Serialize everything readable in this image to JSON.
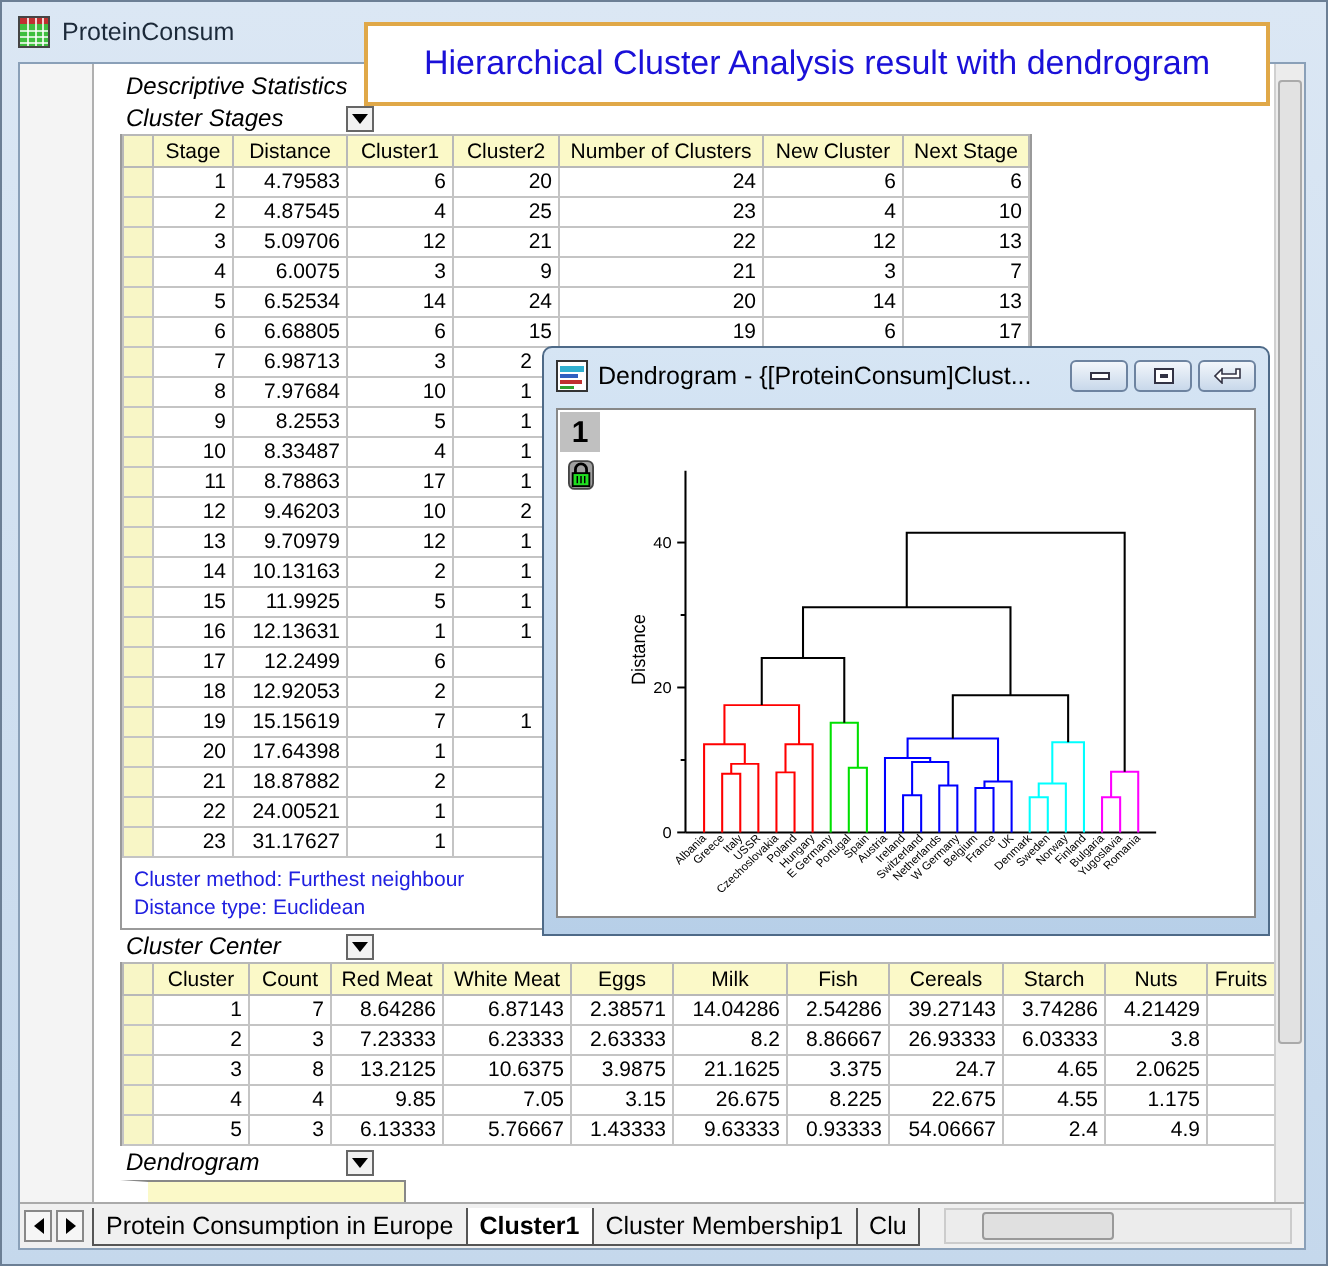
{
  "window": {
    "title": "ProteinConsum"
  },
  "annotation": "Hierarchical Cluster Analysis result with dendrogram",
  "descriptive_statistics_label": "Descriptive Statistics",
  "cluster_stages": {
    "title": "Cluster Stages",
    "columns": [
      "Stage",
      "Distance",
      "Cluster1",
      "Cluster2",
      "Number of Clusters",
      "New Cluster",
      "Next Stage"
    ],
    "rows": [
      [
        "1",
        "4.79583",
        "6",
        "20",
        "24",
        "6",
        "6"
      ],
      [
        "2",
        "4.87545",
        "4",
        "25",
        "23",
        "4",
        "10"
      ],
      [
        "3",
        "5.09706",
        "12",
        "21",
        "22",
        "12",
        "13"
      ],
      [
        "4",
        "6.0075",
        "3",
        "9",
        "21",
        "3",
        "7"
      ],
      [
        "5",
        "6.52534",
        "14",
        "24",
        "20",
        "14",
        "13"
      ],
      [
        "6",
        "6.68805",
        "6",
        "15",
        "19",
        "6",
        "17"
      ],
      [
        "7",
        "6.98713",
        "3",
        "2"
      ],
      [
        "8",
        "7.97684",
        "10",
        "1"
      ],
      [
        "9",
        "8.2553",
        "5",
        "1"
      ],
      [
        "10",
        "8.33487",
        "4",
        "1"
      ],
      [
        "11",
        "8.78863",
        "17",
        "1"
      ],
      [
        "12",
        "9.46203",
        "10",
        "2"
      ],
      [
        "13",
        "9.70979",
        "12",
        "1"
      ],
      [
        "14",
        "10.13163",
        "2",
        "1"
      ],
      [
        "15",
        "11.9925",
        "5",
        "1"
      ],
      [
        "16",
        "12.13631",
        "1",
        "1"
      ],
      [
        "17",
        "12.2499",
        "6"
      ],
      [
        "18",
        "12.92053",
        "2"
      ],
      [
        "19",
        "15.15619",
        "7",
        "1"
      ],
      [
        "20",
        "17.64398",
        "1"
      ],
      [
        "21",
        "18.87882",
        "2"
      ],
      [
        "22",
        "24.00521",
        "1"
      ],
      [
        "23",
        "31.17627",
        "1"
      ]
    ],
    "notes": [
      "Cluster method: Furthest neighbour",
      "Distance type: Euclidean"
    ]
  },
  "cluster_center": {
    "title": "Cluster Center",
    "columns": [
      "Cluster",
      "Count",
      "Red Meat",
      "White Meat",
      "Eggs",
      "Milk",
      "Fish",
      "Cereals",
      "Starch",
      "Nuts",
      "Fruits"
    ],
    "rows": [
      [
        "1",
        "7",
        "8.64286",
        "6.87143",
        "2.38571",
        "14.04286",
        "2.54286",
        "39.27143",
        "3.74286",
        "4.21429"
      ],
      [
        "2",
        "3",
        "7.23333",
        "6.23333",
        "2.63333",
        "8.2",
        "8.86667",
        "26.93333",
        "6.03333",
        "3.8"
      ],
      [
        "3",
        "8",
        "13.2125",
        "10.6375",
        "3.9875",
        "21.1625",
        "3.375",
        "24.7",
        "4.65",
        "2.0625"
      ],
      [
        "4",
        "4",
        "9.85",
        "7.05",
        "3.15",
        "26.675",
        "8.225",
        "22.675",
        "4.55",
        "1.175"
      ],
      [
        "5",
        "3",
        "6.13333",
        "5.76667",
        "1.43333",
        "9.63333",
        "0.93333",
        "54.06667",
        "2.4",
        "4.9"
      ]
    ]
  },
  "dendrogram_section": {
    "title": "Dendrogram"
  },
  "dendrogram_window": {
    "title": "Dendrogram - {[ProteinConsum]Clust...",
    "layer": "1",
    "y_axis_title": "Distance",
    "y_ticks": [
      "40",
      "20",
      "0"
    ],
    "leaves": [
      "Albania",
      "Greece",
      "Italy",
      "USSR",
      "Czechoslovakia",
      "Poland",
      "Hungary",
      "E Germany",
      "Portugal",
      "Spain",
      "Austria",
      "Ireland",
      "Switzerland",
      "Netherlands",
      "W Germany",
      "Belgium",
      "France",
      "UK",
      "Denmark",
      "Sweden",
      "Norway",
      "Finland",
      "Bulgaria",
      "Yugoslavia",
      "Romania"
    ]
  },
  "sheet_tabs": [
    {
      "label": "Protein Consumption in Europe",
      "selected": false
    },
    {
      "label": "Cluster1",
      "selected": true
    },
    {
      "label": "Cluster Membership1",
      "selected": false
    },
    {
      "label": "Clu",
      "selected": false
    }
  ]
}
